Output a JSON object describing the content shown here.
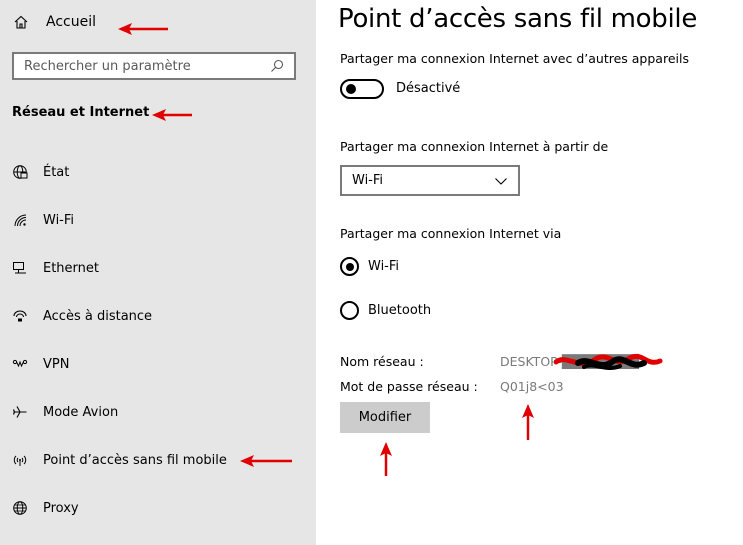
{
  "sidebar": {
    "home_label": "Accueil",
    "search_placeholder": "Rechercher un paramètre",
    "section_title": "Réseau et Internet",
    "items": [
      {
        "label": "État",
        "icon": "globe-status-icon"
      },
      {
        "label": "Wi-Fi",
        "icon": "wifi-icon"
      },
      {
        "label": "Ethernet",
        "icon": "ethernet-icon"
      },
      {
        "label": "Accès à distance",
        "icon": "dial-up-icon"
      },
      {
        "label": "VPN",
        "icon": "vpn-icon"
      },
      {
        "label": "Mode Avion",
        "icon": "airplane-icon"
      },
      {
        "label": "Point d’accès sans fil mobile",
        "icon": "hotspot-icon"
      },
      {
        "label": "Proxy",
        "icon": "globe-icon"
      }
    ]
  },
  "main": {
    "title": "Point d’accès sans fil mobile",
    "share_label": "Partager ma connexion Internet avec d’autres appareils",
    "toggle_state": "Désactivé",
    "share_from_label": "Partager ma connexion Internet à partir de",
    "share_from_value": "Wi-Fi",
    "share_via_label": "Partager ma connexion Internet via",
    "radio_options": [
      {
        "label": "Wi-Fi",
        "checked": true
      },
      {
        "label": "Bluetooth",
        "checked": false
      }
    ],
    "network_name_label": "Nom réseau :",
    "network_name_value": "DESKTOP-████████7",
    "password_label": "Mot de passe réseau :",
    "password_value": "Q01j8<03",
    "edit_button": "Modifier"
  },
  "colors": {
    "sidebar_bg": "#e6e6e6",
    "button_bg": "#cccccc",
    "annotation_arrow": "#e00000",
    "muted_text": "#7a7a7a"
  }
}
